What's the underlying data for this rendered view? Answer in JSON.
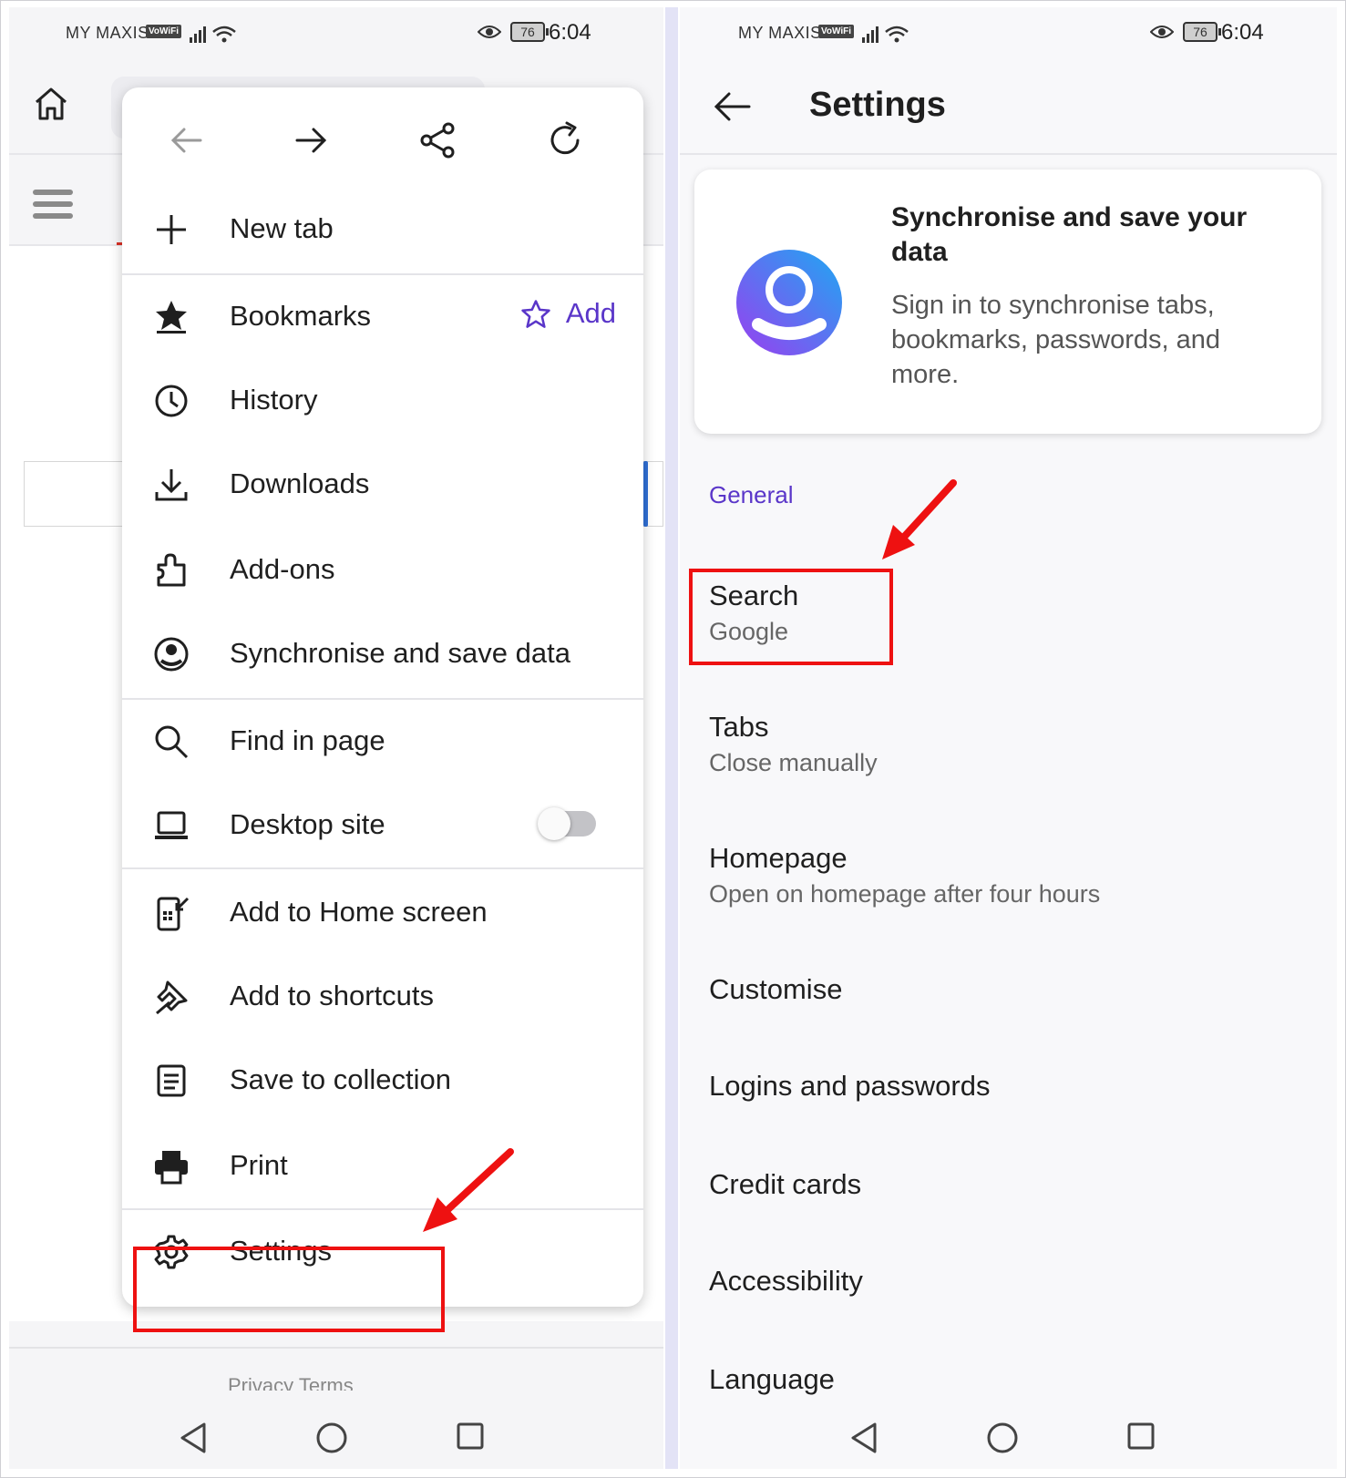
{
  "status_bar": {
    "carrier": "MY MAXIS",
    "vowifi": "VoWiFi",
    "battery": "76",
    "time": "6:04"
  },
  "left": {
    "footer_text": "Privacy      Terms",
    "menu": {
      "items": [
        {
          "label": "New tab"
        },
        {
          "label": "Bookmarks",
          "action": "Add"
        },
        {
          "label": "History"
        },
        {
          "label": "Downloads"
        },
        {
          "label": "Add-ons"
        },
        {
          "label": "Synchronise and save data"
        },
        {
          "label": "Find in page"
        },
        {
          "label": "Desktop site",
          "toggle": "off"
        },
        {
          "label": "Add to Home screen"
        },
        {
          "label": "Add to shortcuts"
        },
        {
          "label": "Save to collection"
        },
        {
          "label": "Print"
        },
        {
          "label": "Settings"
        }
      ]
    }
  },
  "right": {
    "title": "Settings",
    "sync_card": {
      "title": "Synchronise and save your data",
      "description": "Sign in to synchronise tabs, bookmarks, passwords, and more."
    },
    "section": "General",
    "items": [
      {
        "title": "Search",
        "subtitle": "Google"
      },
      {
        "title": "Tabs",
        "subtitle": "Close manually"
      },
      {
        "title": "Homepage",
        "subtitle": "Open on homepage after four hours"
      },
      {
        "title": "Customise"
      },
      {
        "title": "Logins and passwords"
      },
      {
        "title": "Credit cards"
      },
      {
        "title": "Accessibility"
      },
      {
        "title": "Language"
      }
    ]
  },
  "colors": {
    "accent": "#5a36c9",
    "highlight": "#ee1111",
    "annotation_arrow": "#ee1111"
  }
}
